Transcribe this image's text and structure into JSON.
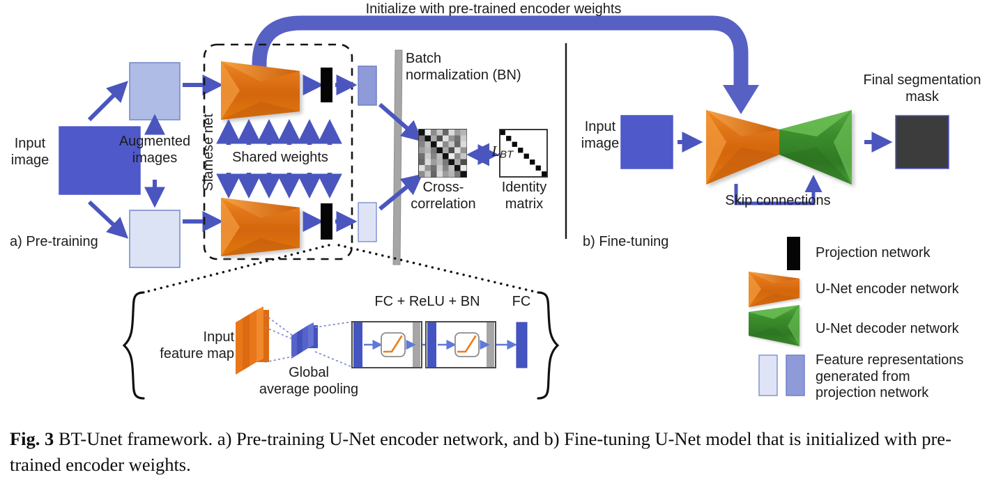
{
  "figure": {
    "top_label": "Initialize with pre-trained encoder weights",
    "caption_bold": "Fig. 3",
    "caption_text": "BT-Unet framework. a) Pre-training U-Net encoder network, and b) Fine-tuning U-Net model that is initialized with pre-trained encoder weights."
  },
  "panel_a": {
    "tag": "a) Pre-training",
    "input_image_label": "Input\nimage",
    "augmented_label": "Augmented\nimages",
    "siamese_label": "Siamese net",
    "shared_weights_label": "Shared weights",
    "batch_norm_label": "Batch\nnormalization (BN)",
    "cross_correlation_label": "Cross-\ncorrelation",
    "identity_label": "Identity\nmatrix",
    "loss_symbol": "L",
    "loss_subscript": "BT",
    "shared_arrow_count": 6
  },
  "panel_b": {
    "tag": "b) Fine-tuning",
    "input_image_label": "Input\nimage",
    "skip_label": "Skip connections",
    "output_label": "Final segmentation\nmask"
  },
  "detail": {
    "input_feature_map_label": "Input\nfeature map",
    "gap_label": "Global\naverage pooling",
    "fc_relu_bn_label": "FC + ReLU + BN",
    "fc_label": "FC"
  },
  "legend": {
    "items": [
      {
        "label": "Projection network",
        "swatch": "black-bar"
      },
      {
        "label": "U-Net encoder network",
        "swatch": "orange-trapezoid"
      },
      {
        "label": "U-Net decoder network",
        "swatch": "green-trapezoid"
      },
      {
        "label": "Feature representations\ngenerated from\nprojection network",
        "swatch": "blue-bars-pair"
      }
    ]
  },
  "colors": {
    "blue_arrow": "#4A56BE",
    "input_image_blue": "#5059C9",
    "augmented_light": "#DCE3F5",
    "augmented_mid": "#AFBCE6",
    "feature_dark": "#8E9BD8",
    "feature_light": "#DEE4F6",
    "encoder_orange": "#D9690B",
    "decoder_green": "#3A8C2E",
    "projection_black": "#050505",
    "bn_gray": "#A6A6A6",
    "mask_dark": "#3C3C3C",
    "fc_blue": "#4455C2"
  }
}
